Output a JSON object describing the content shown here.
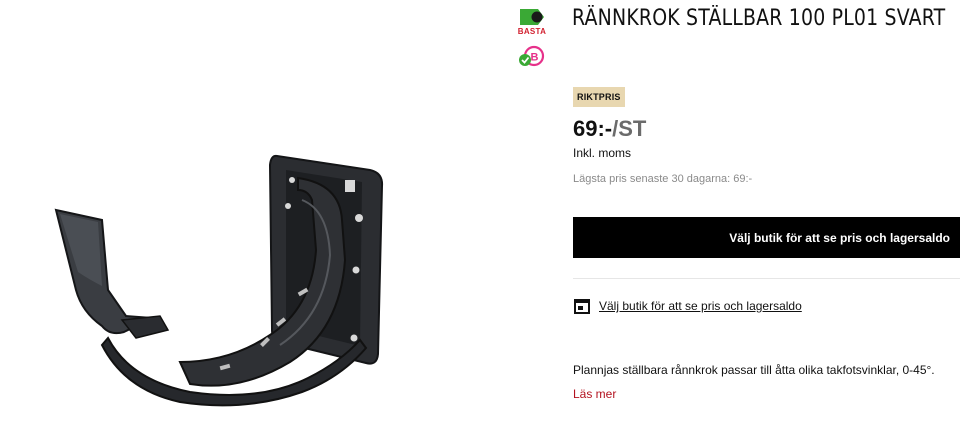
{
  "product": {
    "title": "RÄNNKROK STÄLLBAR 100 PL01 SVART",
    "image_alt": "Rännkrok ställbar svart"
  },
  "badges": {
    "basta_label": "BASTA",
    "basta_icon": "basta-badge-icon",
    "b_icon": "byggvarubedomningen-icon"
  },
  "pricing": {
    "tag": "RIKTPRIS",
    "price": "69:-",
    "unit": "/ST",
    "vat_note": "Inkl. moms",
    "lowest_price": "Lägsta pris senaste 30 dagarna: 69:-"
  },
  "actions": {
    "cta_label": "Välj butik för att se pris och lagersaldo",
    "store_link_label": "Välj butik för att se pris och lagersaldo",
    "store_icon": "store-icon"
  },
  "description": {
    "text": "Plannjas ställbara rånnkrok passar till åtta olika takfotsvinklar, 0-45°.",
    "read_more": "Läs mer"
  },
  "colors": {
    "accent_red": "#b3121f",
    "price_tag_bg": "#e8d7b0",
    "basta_green": "#3aa935",
    "basta_red": "#d2202f",
    "badge_pink": "#e6318a"
  }
}
